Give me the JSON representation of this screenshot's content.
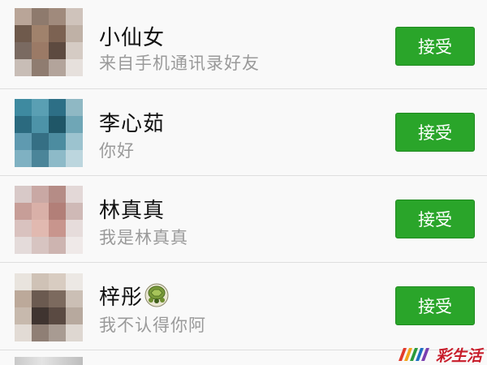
{
  "requests": [
    {
      "name": "小仙女",
      "message": "来自手机通讯录好友",
      "accept_label": "接受",
      "has_emoji": false
    },
    {
      "name": "李心茹",
      "message": "你好",
      "accept_label": "接受",
      "has_emoji": false
    },
    {
      "name": "林真真",
      "message": "我是林真真",
      "accept_label": "接受",
      "has_emoji": false
    },
    {
      "name": "梓彤",
      "message": "我不认得你阿",
      "accept_label": "接受",
      "has_emoji": true,
      "emoji_icon": "turtle-icon"
    }
  ],
  "watermark": {
    "text": "彩生活",
    "logo_icon": "brand-logo-icon"
  },
  "colors": {
    "accept_button": "#2aa52a",
    "name_text": "#111111",
    "message_text": "#9a9a9a",
    "background": "#f9f9f9",
    "watermark": "#c81c2a"
  }
}
